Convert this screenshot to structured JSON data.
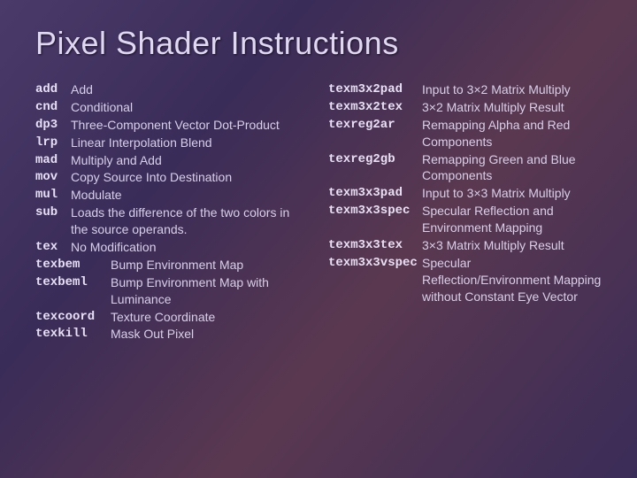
{
  "title": "Pixel Shader Instructions",
  "left": {
    "r0": {
      "mn": "add",
      "desc": "Add"
    },
    "r1": {
      "mn": "cnd",
      "desc": "Conditional"
    },
    "r2": {
      "mn": "dp3",
      "desc": "Three-Component Vector Dot-Product"
    },
    "r3": {
      "mn": "lrp",
      "desc": "Linear Interpolation Blend"
    },
    "r4": {
      "mn": "mad",
      "desc": "Multiply and Add"
    },
    "r5": {
      "mn": "mov",
      "desc": "Copy Source Into Destination"
    },
    "r6": {
      "mn": "mul",
      "desc": "Modulate"
    },
    "r7": {
      "mn": "sub",
      "desc": "Loads the difference of the two colors in the source operands."
    },
    "r8": {
      "mn": "tex",
      "desc": "No Modification"
    },
    "r9": {
      "mn": "texbem",
      "desc": "Bump Environment Map"
    },
    "r10": {
      "mn": "texbeml",
      "desc": "Bump Environment Map with Luminance"
    },
    "r11": {
      "mn": "texcoord",
      "desc": "Texture Coordinate"
    },
    "r12": {
      "mn": "texkill",
      "desc": "Mask Out Pixel"
    }
  },
  "right": {
    "r0": {
      "mn": "texm3x2pad",
      "desc": "Input to 3×2 Matrix Multiply"
    },
    "r1": {
      "mn": "texm3x2tex",
      "desc": "3×2 Matrix Multiply Result"
    },
    "r2": {
      "mn": "texreg2ar",
      "desc": "Remapping Alpha and Red Components"
    },
    "r3": {
      "mn": "texreg2gb",
      "desc": "Remapping Green and Blue Components"
    },
    "r4": {
      "mn": "texm3x3pad",
      "desc": "Input to 3×3 Matrix Multiply"
    },
    "r5": {
      "mn": "texm3x3spec",
      "desc": "Specular Reflection and Environment Mapping"
    },
    "r6": {
      "mn": "texm3x3tex",
      "desc": "3×3 Matrix Multiply Result"
    },
    "r7": {
      "mn": "texm3x3vspec",
      "desc": "Specular Reflection/Environment Mapping without Constant Eye Vector"
    }
  }
}
